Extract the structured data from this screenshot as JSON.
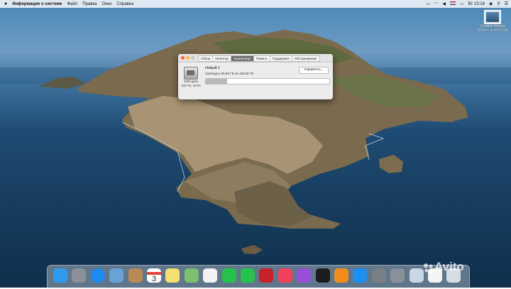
{
  "menubar": {
    "app_name": "Информация о системе",
    "items": [
      "Файл",
      "Правка",
      "Окно",
      "Справка"
    ],
    "clock": "Вт 13:18"
  },
  "desktop_icon": {
    "label_line1": "Снимок экрана",
    "label_line2": "2024-0...в 13.17.06"
  },
  "window": {
    "tabs": [
      "Обзор",
      "Монитор",
      "Хранилище",
      "Память",
      "Поддержка",
      "Обслуживание"
    ],
    "active_tab": "Хранилище",
    "disk_name": "Новый 1",
    "free_text": "Свободно 99,65 ГБ из 119,82 ГБ",
    "disk_type_line1": "SSD-диск",
    "disk_type_line2": "120 ГБ, SATA",
    "manage_label": "Управлять...",
    "used_fraction": 0.17
  },
  "dock": {
    "apps": [
      {
        "name": "finder-icon",
        "color": "#2f9bf0"
      },
      {
        "name": "launchpad-icon",
        "color": "#8a8f98"
      },
      {
        "name": "safari-icon",
        "color": "#1b8cf2"
      },
      {
        "name": "preview-icon",
        "color": "#6aa2d8"
      },
      {
        "name": "contacts-icon",
        "color": "#b88a55"
      },
      {
        "name": "calendar-icon",
        "color": "#ffffff"
      },
      {
        "name": "notes-icon",
        "color": "#f5e071"
      },
      {
        "name": "maps-icon",
        "color": "#7dc070"
      },
      {
        "name": "photos-icon",
        "color": "#f2f2f2"
      },
      {
        "name": "messages-icon",
        "color": "#27c24c"
      },
      {
        "name": "facetime-icon",
        "color": "#27c24c"
      },
      {
        "name": "photo-booth-icon",
        "color": "#c7222a"
      },
      {
        "name": "music-icon",
        "color": "#f5405b"
      },
      {
        "name": "podcasts-icon",
        "color": "#9a4fd8"
      },
      {
        "name": "tv-icon",
        "color": "#1c1c1c"
      },
      {
        "name": "books-icon",
        "color": "#f28d1c"
      },
      {
        "name": "app-store-icon",
        "color": "#1d8ff0"
      },
      {
        "name": "system-preferences-icon",
        "color": "#7a7f87"
      },
      {
        "name": "utility-icon",
        "color": "#8a9099"
      },
      {
        "name": "screenshot-icon",
        "color": "#c9d6e4"
      },
      {
        "name": "document-icon",
        "color": "#f4f4f4"
      },
      {
        "name": "trash-icon",
        "color": "#d7dde4"
      }
    ],
    "calendar_day": "3"
  },
  "watermark": "Avito"
}
